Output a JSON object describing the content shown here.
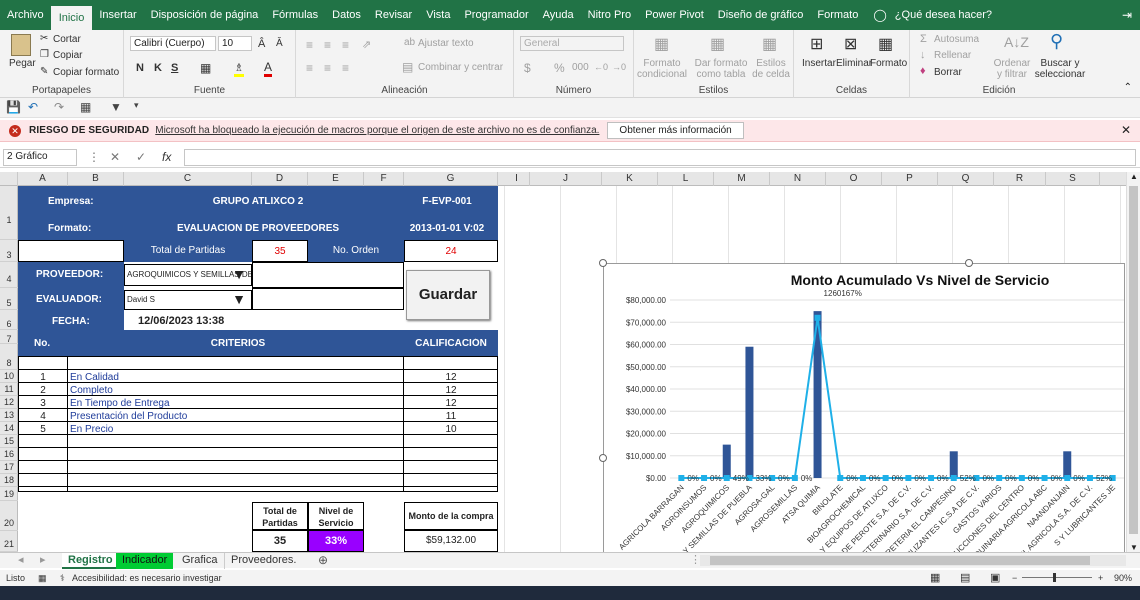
{
  "menu": {
    "tabs": [
      "Archivo",
      "Inicio",
      "Insertar",
      "Disposición de página",
      "Fórmulas",
      "Datos",
      "Revisar",
      "Vista",
      "Programador",
      "Ayuda",
      "Nitro Pro",
      "Power Pivot",
      "Diseño de gráfico",
      "Formato"
    ],
    "active": "Inicio",
    "tellme": "¿Qué desea hacer?"
  },
  "ribbon": {
    "paste": "Pegar",
    "cut": "Cortar",
    "copy": "Copiar",
    "format_painter": "Copiar formato",
    "clipboard": "Portapapeles",
    "font_name": "Calibri (Cuerpo)",
    "font_size": "10",
    "bold": "N",
    "italic": "K",
    "underline": "S",
    "font_group": "Fuente",
    "wrap_text": "Ajustar texto",
    "merge_center": "Combinar y centrar",
    "alignment": "Alineación",
    "number_format": "General",
    "number": "Número",
    "conditional_format": "Formato condicional",
    "format_table": "Dar formato como tabla",
    "cell_styles": "Estilos de celda",
    "styles": "Estilos",
    "insert": "Insertar",
    "delete": "Eliminar",
    "format": "Formato",
    "cells": "Celdas",
    "autosum": "Autosuma",
    "fill": "Rellenar",
    "clear": "Borrar",
    "sort_filter": "Ordenar y filtrar",
    "find_select": "Buscar y seleccionar",
    "editing": "Edición"
  },
  "security": {
    "label": "RIESGO DE SEGURIDAD",
    "message": "Microsoft ha bloqueado la ejecución de macros porque el origen de este archivo no es de confianza.",
    "button": "Obtener más información"
  },
  "formula_bar": {
    "name_box": "2 Gráfico",
    "fx": "fx",
    "formula": ""
  },
  "columns": [
    "A",
    "B",
    "C",
    "D",
    "E",
    "F",
    "G",
    "I",
    "J",
    "K",
    "L",
    "M",
    "N",
    "O",
    "P",
    "Q",
    "R",
    "S"
  ],
  "rows": [
    "1",
    "2",
    "3",
    "4",
    "5",
    "6",
    "7",
    "8",
    "10",
    "11",
    "12",
    "13",
    "14",
    "15",
    "16",
    "17",
    "18",
    "19",
    "20",
    "21"
  ],
  "form": {
    "empresa_label": "Empresa:",
    "empresa_value": "GRUPO ATLIXCO 2",
    "code1": "F-EVP-001",
    "formato_label": "Formato:",
    "formato_value": "EVALUACION DE PROVEEDORES",
    "code2": "2013-01-01 V:02",
    "total_partidas_label": "Total de Partidas",
    "total_partidas_value": "35",
    "no_orden_label": "No. Orden",
    "no_orden_value": "24",
    "proveedor_label": "PROVEEDOR:",
    "proveedor_value": "AGROQUIMICOS Y SEMILLAS DE",
    "evaluador_label": "EVALUADOR:",
    "evaluador_value": "David S",
    "fecha_label": "FECHA:",
    "fecha_value": "12/06/2023 13:38",
    "save_button": "Guardar",
    "no_header": "No.",
    "criterios_header": "CRITERIOS",
    "calificacion_header": "CALIFICACIÓN",
    "criteria": [
      {
        "no": "1",
        "name": "En Calidad",
        "score": "12"
      },
      {
        "no": "2",
        "name": "Completo",
        "score": "12"
      },
      {
        "no": "3",
        "name": "En Tiempo de Entrega",
        "score": "12"
      },
      {
        "no": "4",
        "name": "Presentación del Producto",
        "score": "11"
      },
      {
        "no": "5",
        "name": "En Precio",
        "score": "10"
      }
    ],
    "summary_total_label": "Total de Partidas",
    "summary_total_value": "35",
    "summary_nivel_label": "Nivel de Servicio",
    "summary_nivel_value": "33%",
    "monto_label": "Monto de la compra",
    "monto_value": "$59,132.00"
  },
  "chart_data": {
    "type": "bar",
    "title": "Monto Acumulado Vs Nivel de Servicio",
    "ylim": [
      0,
      80000
    ],
    "yticks": [
      "$0.00",
      "$10,000.00",
      "$20,000.00",
      "$30,000.00",
      "$40,000.00",
      "$50,000.00",
      "$60,000.00",
      "$70,000.00",
      "$80,000.00"
    ],
    "categories": [
      "AGRICOLA BARRAGAN",
      "AGROINSUMOS",
      "AGROQUIMICOS",
      "S Y SEMILLAS DE PUEBLA",
      "AGROSA-GAL",
      "AGROSEMILLAS",
      "ATSA QUIMIA",
      "BINOLATE",
      "BIOAGROCHEMICAL",
      "AS Y EQUIPOS DE ATLIXCO",
      "QUINARIA DE PEROTE S.A. DE C.V.",
      "VETERINARIO S.A. DE C.V.",
      "FERRETERIA EL CAMPESINO",
      "RTILIZANTES IC.S.A DE C.V.",
      "GASTOS VARIOS",
      "TRUCCIONES DEL CENTRO",
      "QUINARIA AGRICOLA ABC",
      "NAANDANJAIN",
      "SIL AGRICOLA S.A. DE C.V.",
      "S Y LUBRICANTES JE"
    ],
    "series": [
      {
        "values": [
          0,
          0,
          15000,
          59000,
          0,
          0,
          75000,
          0,
          0,
          0,
          0,
          0,
          12000,
          0,
          0,
          0,
          0,
          12000,
          0,
          0
        ]
      },
      {
        "values": [
          0,
          0,
          0,
          0,
          0,
          0,
          72000,
          0,
          0,
          0,
          0,
          0,
          0,
          0,
          0,
          0,
          0,
          0,
          0,
          0
        ]
      }
    ],
    "data_labels": [
      "0%",
      "0%",
      "49%",
      "33%",
      "0%",
      "0%",
      "1260167%",
      "0%",
      "0%",
      "0%",
      "0%",
      "0%",
      "52%",
      "0%",
      "0%",
      "0%",
      "0%",
      "0%",
      "52%",
      ""
    ]
  },
  "sheets": {
    "tabs": [
      "Registro",
      "Indicador",
      "Grafica",
      "Proveedores."
    ],
    "active": "Registro"
  },
  "status": {
    "ready": "Listo",
    "accessibility": "Accesibilidad: es necesario investigar",
    "zoom": "90%"
  }
}
